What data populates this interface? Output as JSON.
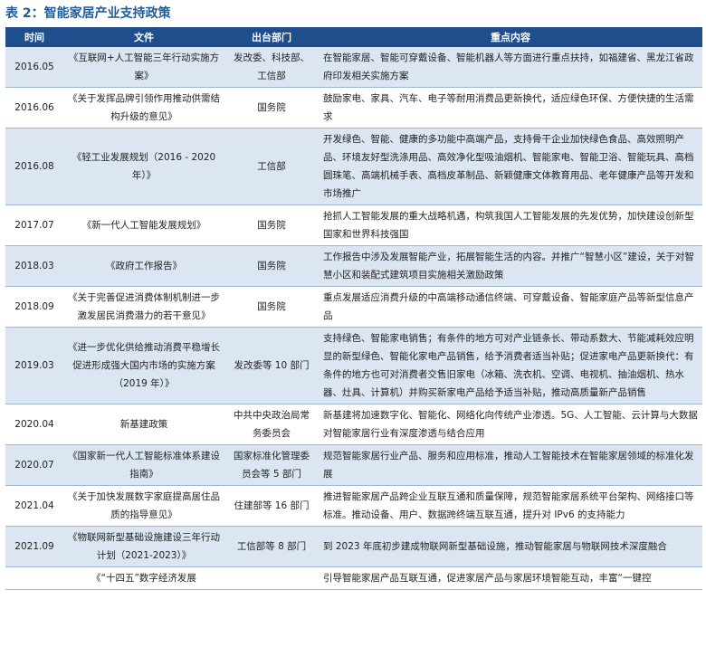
{
  "title": "表 2：智能家居产业支持政策",
  "headers": {
    "time": "时间",
    "file": "文件",
    "dept": "出台部门",
    "content": "重点内容"
  },
  "rows": [
    {
      "time": "2016.05",
      "file": "《互联网+人工智能三年行动实施方案》",
      "dept": "发改委、科技部、工信部",
      "content": "在智能家居、智能可穿戴设备、智能机器人等方面进行重点扶持，如福建省、黑龙江省政府印发相关实施方案"
    },
    {
      "time": "2016.06",
      "file": "《关于发挥品牌引领作用推动供需结构升级的意见》",
      "dept": "国务院",
      "content": "鼓励家电、家具、汽车、电子等耐用消费品更新换代，适应绿色环保、方便快捷的生活需求"
    },
    {
      "time": "2016.08",
      "file": "《轻工业发展规划（2016 - 2020 年）》",
      "dept": "工信部",
      "content": "开发绿色、智能、健康的多功能中高端产品，支持骨干企业加快绿色食品、高效照明产品、环境友好型洗涤用品、高效净化型吸油烟机、智能家电、智能卫浴、智能玩具、高档圆珠笔、高端机械手表、高档皮革制品、新颖健康文体教育用品、老年健康产品等开发和市场推广"
    },
    {
      "time": "2017.07",
      "file": "《新一代人工智能发展规划》",
      "dept": "国务院",
      "content": "抢抓人工智能发展的重大战略机遇，构筑我国人工智能发展的先发优势，加快建设创新型国家和世界科技强国"
    },
    {
      "time": "2018.03",
      "file": "《政府工作报告》",
      "dept": "国务院",
      "content": "工作报告中涉及发展智能产业，拓展智能生活的内容。并推广“智慧小区”建设，关于对智慧小区和装配式建筑项目实施相关激励政策"
    },
    {
      "time": "2018.09",
      "file": "《关于完善促进消费体制机制进一步激发居民消费潜力的若干意见》",
      "dept": "国务院",
      "content": "重点发展适应消费升级的中高端移动通信终端、可穿戴设备、智能家庭产品等新型信息产品"
    },
    {
      "time": "2019.03",
      "file": "《进一步优化供给推动消费平稳增长促进形成强大国内市场的实施方案（2019 年）》",
      "dept": "发改委等 10 部门",
      "content": "支持绿色、智能家电销售；有条件的地方可对产业链条长、带动系数大、节能减耗效应明显的新型绿色、智能化家电产品销售，给予消费者适当补贴；促进家电产品更新换代：有条件的地方也可对消费者交售旧家电（冰箱、洗衣机、空调、电视机、抽油烟机、热水器、灶具、计算机）并购买新家电产品给予适当补贴，推动高质量新产品销售"
    },
    {
      "time": "2020.04",
      "file": "新基建政策",
      "dept": "中共中央政治局常务委员会",
      "content": "新基建将加速数字化、智能化、网络化向传统产业渗透。5G、人工智能、云计算与大数据对智能家居行业有深度渗透与结合应用"
    },
    {
      "time": "2020.07",
      "file": "《国家新一代人工智能标准体系建设指南》",
      "dept": "国家标准化管理委员会等 5 部门",
      "content": "规范智能家居行业产品、服务和应用标准，推动人工智能技术在智能家居领域的标准化发展"
    },
    {
      "time": "2021.04",
      "file": "《关于加快发展数字家庭提高居住品质的指导意见》",
      "dept": "住建部等 16 部门",
      "content": "推进智能家居产品跨企业互联互通和质量保障，规范智能家居系统平台架构、网络接口等标准。推动设备、用户、数据跨终端互联互通，提升对 IPv6 的支持能力"
    },
    {
      "time": "2021.09",
      "file": "《物联网新型基础设施建设三年行动计划（2021-2023）》",
      "dept": "工信部等 8 部门",
      "content": "到 2023 年底初步建成物联网新型基础设施，推动智能家居与物联网技术深度融合"
    },
    {
      "time": "",
      "file": "《“十四五”数字经济发展",
      "dept": "",
      "content": "引导智能家居产品互联互通，促进家居产品与家居环境智能互动，丰富“一键控"
    }
  ]
}
